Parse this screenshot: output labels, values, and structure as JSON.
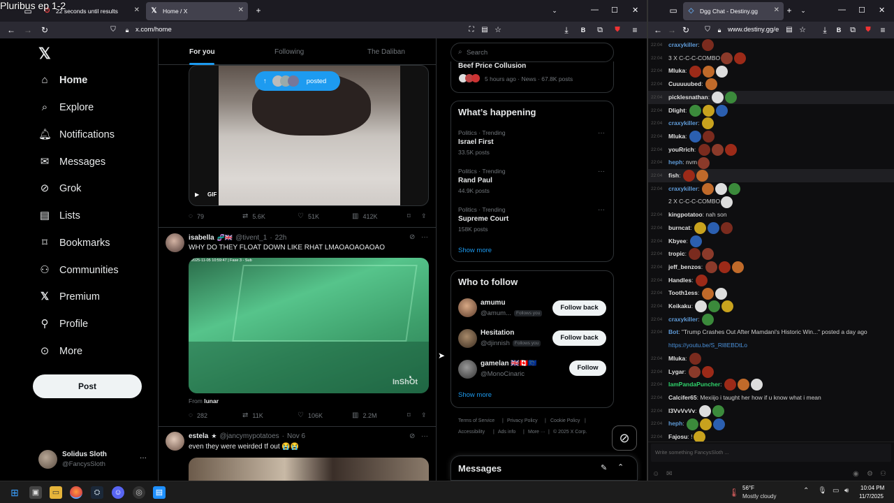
{
  "overlay_title": "Pluribus ep 1-2",
  "left_browser": {
    "tabs": [
      {
        "label": "22 seconds until results",
        "active": false
      },
      {
        "label": "Home / X",
        "active": true
      }
    ],
    "url": "x.com/home"
  },
  "x": {
    "nav": [
      "Home",
      "Explore",
      "Notifications",
      "Messages",
      "Grok",
      "Lists",
      "Bookmarks",
      "Communities",
      "Premium",
      "Profile",
      "More"
    ],
    "post_button": "Post",
    "account": {
      "name": "Solidus Sloth",
      "handle": "@FancysSloth"
    },
    "feed_tabs": [
      "For you",
      "Following",
      "The Daliban"
    ],
    "posted_pill": "posted",
    "gif_label": "GIF",
    "tweet1_stats": {
      "replies": "79",
      "reposts": "5.6K",
      "likes": "51K",
      "views": "412K"
    },
    "tweet2": {
      "name": "isabella",
      "handle": "@tivent_1",
      "time": "22h",
      "text": "WHY DO THEY FLOAT DOWN LIKE RHAT LMAOAOAOAOAO",
      "video_overlay": "2025-11-05 10:59:47 | Fase 3 - Sub",
      "video_watermark": "InShOt",
      "from_label": "From",
      "from_user": "lunar",
      "stats": {
        "replies": "282",
        "reposts": "11K",
        "likes": "106K",
        "views": "2.2M"
      }
    },
    "tweet3": {
      "name": "estela",
      "handle": "@jancymypotatoes",
      "time": "Nov 6",
      "text": "even they were weirded tf out 😭😭"
    },
    "search_placeholder": "Search",
    "top_trend": {
      "name": "Beef Price Collusion",
      "meta": "5 hours ago · News · 67.8K posts"
    },
    "whats_happening": {
      "title": "What’s happening",
      "trends": [
        {
          "meta": "Politics · Trending",
          "name": "Israel First",
          "count": "33.5K posts"
        },
        {
          "meta": "Politics · Trending",
          "name": "Rand Paul",
          "count": "44.9K posts"
        },
        {
          "meta": "Politics · Trending",
          "name": "Supreme Court",
          "count": "158K posts"
        }
      ],
      "show_more": "Show more"
    },
    "who_to_follow": {
      "title": "Who to follow",
      "users": [
        {
          "name": "amumu",
          "handle": "@amum...",
          "badge": "Follows you",
          "button": "Follow back"
        },
        {
          "name": "Hesitation",
          "handle": "@djinnish",
          "badge": "Follows you",
          "button": "Follow back"
        },
        {
          "name": "gamelan 🇬🇧🇨🇦🇪🇺",
          "handle": "@MonoCinaric",
          "badge": "",
          "button": "Follow"
        }
      ],
      "show_more": "Show more"
    },
    "footer": [
      "Terms of Service",
      "Privacy Policy",
      "Cookie Policy",
      "Accessibility",
      "Ads info",
      "More ···",
      "© 2025 X Corp."
    ],
    "messages_title": "Messages"
  },
  "right_browser": {
    "tab": "Dgg Chat - Destiny.gg",
    "url": "www.destiny.gg/e",
    "chat_placeholder": "Write something FancysSloth ...",
    "lines": [
      {
        "ts": "22:04",
        "user": "craxykiller",
        "color": "blue",
        "msg": ""
      },
      {
        "ts": "22:04",
        "user": "",
        "color": "",
        "msg": "3 X C-C-C-COMBO"
      },
      {
        "ts": "22:04",
        "user": "Mluka",
        "color": "",
        "msg": ""
      },
      {
        "ts": "22:04",
        "user": "Cuuuuubed",
        "color": "",
        "msg": ""
      },
      {
        "ts": "22:04",
        "user": "picklesnathan",
        "color": "",
        "msg": ""
      },
      {
        "ts": "22:04",
        "user": "Dlight",
        "color": "",
        "msg": ""
      },
      {
        "ts": "22:04",
        "user": "craxykiller",
        "color": "blue",
        "msg": ""
      },
      {
        "ts": "22:04",
        "user": "Mluka",
        "color": "",
        "msg": ""
      },
      {
        "ts": "22:04",
        "user": "youRrich",
        "color": "",
        "msg": ""
      },
      {
        "ts": "22:04",
        "user": "heph",
        "color": "blue",
        "msg": "nvm"
      },
      {
        "ts": "22:04",
        "user": "fish",
        "color": "",
        "msg": ""
      },
      {
        "ts": "22:04",
        "user": "craxykiller",
        "color": "blue",
        "msg": ""
      },
      {
        "ts": "",
        "user": "",
        "color": "",
        "msg": "2 X C-C-C-COMBO"
      },
      {
        "ts": "22:04",
        "user": "kingpotatoo",
        "color": "",
        "msg": "nah son"
      },
      {
        "ts": "22:04",
        "user": "burncat",
        "color": "",
        "msg": ""
      },
      {
        "ts": "22:04",
        "user": "Kbyee",
        "color": "",
        "msg": ""
      },
      {
        "ts": "22:04",
        "user": "tropic",
        "color": "",
        "msg": ""
      },
      {
        "ts": "22:04",
        "user": "jeff_benzos",
        "color": "",
        "msg": ""
      },
      {
        "ts": "22:04",
        "user": "Handles",
        "color": "",
        "msg": ""
      },
      {
        "ts": "22:04",
        "user": "Tooth1ess",
        "color": "",
        "msg": ""
      },
      {
        "ts": "22:04",
        "user": "Keikaku",
        "color": "",
        "msg": ""
      },
      {
        "ts": "22:04",
        "user": "craxykiller",
        "color": "blue",
        "msg": ""
      },
      {
        "ts": "22:04",
        "user": "Bot",
        "color": "blue",
        "msg": "\"Trump Crashes Out After Mamdani's Historic Win...\" posted a day ago"
      },
      {
        "ts": "",
        "user": "",
        "color": "link",
        "msg": "https://youtu.be/S_Rl8EBDtLo"
      },
      {
        "ts": "22:04",
        "user": "Mluka",
        "color": "",
        "msg": ""
      },
      {
        "ts": "22:04",
        "user": "Lygar",
        "color": "",
        "msg": ""
      },
      {
        "ts": "22:04",
        "user": "IamPandaPuncher",
        "color": "green",
        "msg": ""
      },
      {
        "ts": "22:04",
        "user": "Calcifer65",
        "color": "",
        "msg": "Mexiijo i taught her how if u know what i mean"
      },
      {
        "ts": "22:04",
        "user": "I3VvVvVv",
        "color": "",
        "msg": ""
      },
      {
        "ts": "22:04",
        "user": "heph",
        "color": "blue",
        "msg": ""
      },
      {
        "ts": "22:04",
        "user": "Fajosu",
        "color": "",
        "msg": "!"
      }
    ]
  },
  "taskbar": {
    "weather_temp": "56°F",
    "weather_desc": "Mostly cloudy",
    "time": "10:04 PM",
    "date": "11/7/2025"
  }
}
